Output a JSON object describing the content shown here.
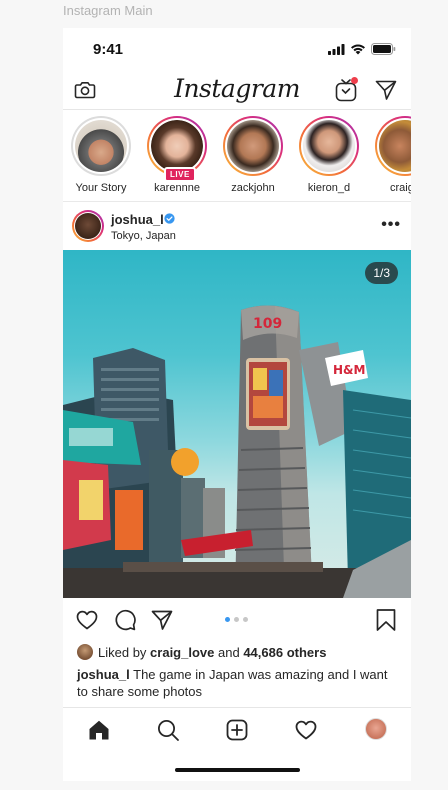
{
  "frame_label": "Instagram Main",
  "status_bar": {
    "time": "9:41"
  },
  "nav": {
    "logo": "Instagram",
    "icons": [
      "camera-icon",
      "igtv-icon",
      "direct-message-icon"
    ],
    "notification_dot_color": "#ee3e4b"
  },
  "stories": [
    {
      "name": "Your Story",
      "live": false
    },
    {
      "name": "karennne",
      "live": true,
      "badge": "LIVE"
    },
    {
      "name": "zackjohn",
      "live": false
    },
    {
      "name": "kieron_d",
      "live": false
    },
    {
      "name": "craig_",
      "live": false
    }
  ],
  "post": {
    "username": "joshua_l",
    "verified": true,
    "location": "Tokyo, Japan",
    "more": "•••",
    "counter": "1/3",
    "carousel": {
      "count": 3,
      "active": 1
    },
    "likes": {
      "prefix": "Liked by",
      "first_liker": "craig_love",
      "joiner": "and",
      "others": "44,686 others"
    },
    "caption_user": "joshua_l",
    "caption_text": " The game in Japan was amazing and I want to share some photos"
  },
  "tabbar": {
    "icons": [
      "home-icon",
      "search-icon",
      "new-post-icon",
      "activity-heart-icon",
      "profile-avatar"
    ]
  },
  "colors": {
    "accent": "#3897f0",
    "live": "#e0245e",
    "verified": "#3897f0"
  }
}
